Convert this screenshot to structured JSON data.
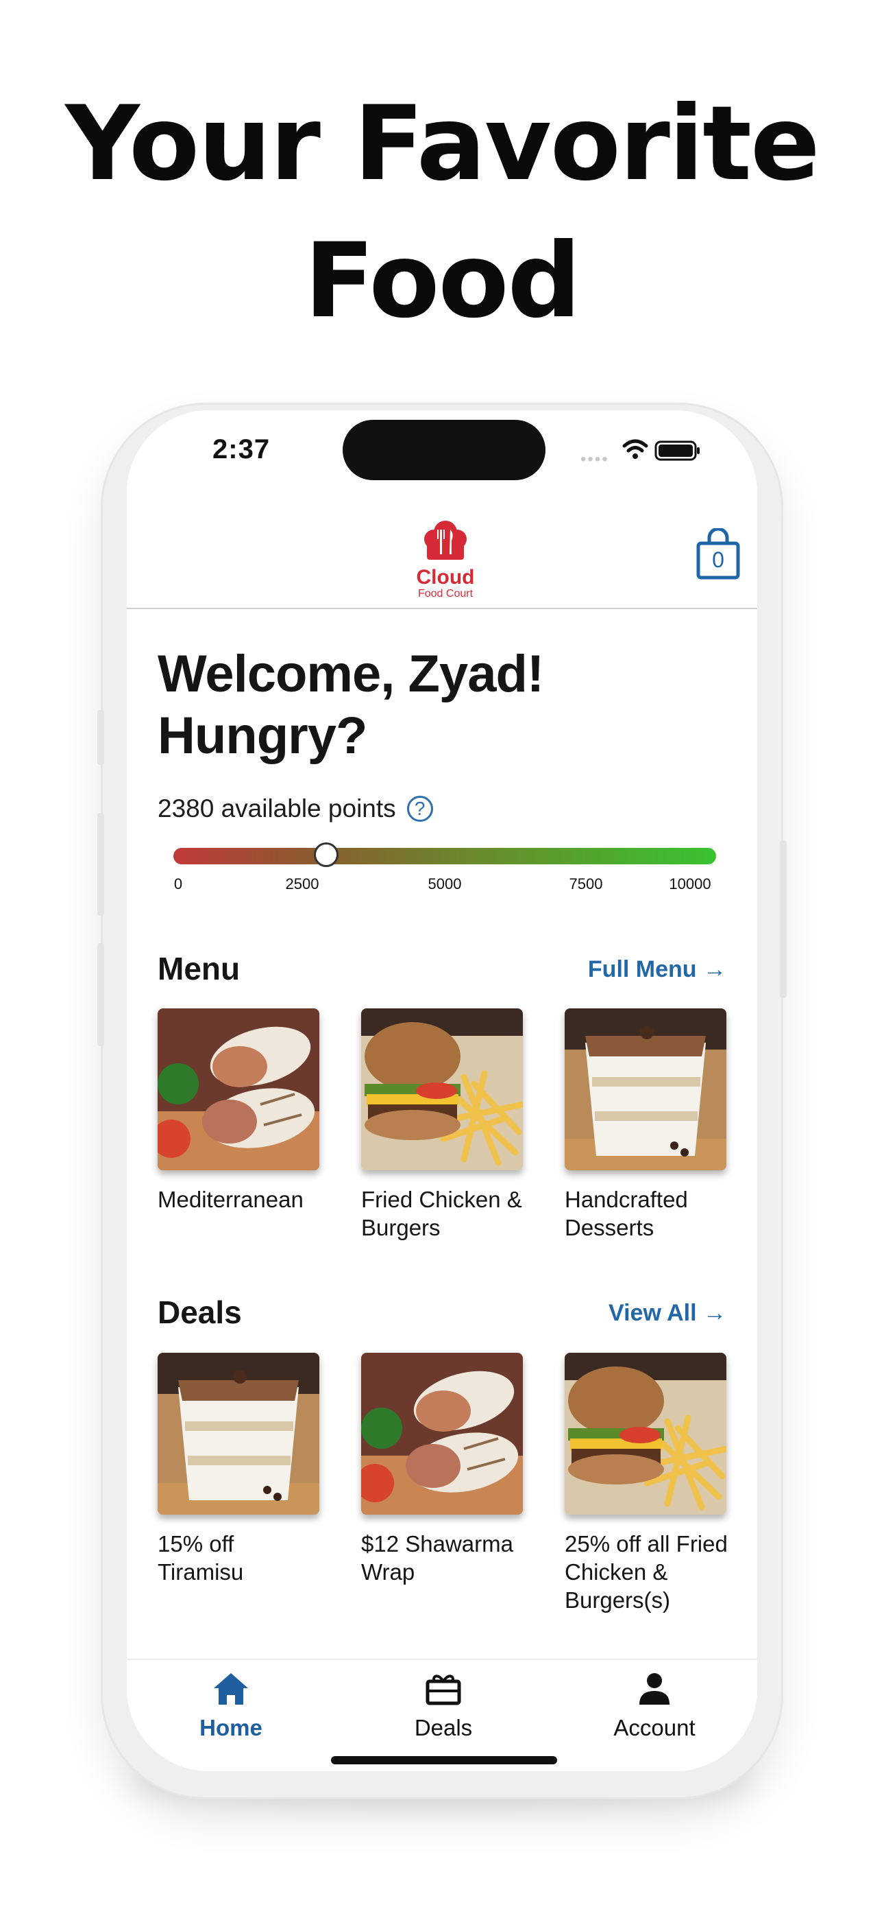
{
  "headline": {
    "line1": "Your Favorite",
    "line2": "Food"
  },
  "status_bar": {
    "time": "2:37"
  },
  "header": {
    "logo": {
      "name": "Cloud",
      "subtitle": "Food Court"
    },
    "cart_count": "0"
  },
  "welcome": {
    "line1": "Welcome, Zyad!",
    "line2": "Hungry?"
  },
  "points": {
    "label": "2380 available points",
    "help_glyph": "?",
    "value": 2380,
    "max": 10000,
    "ticks": [
      "0",
      "2500",
      "5000",
      "7500",
      "10000"
    ]
  },
  "menu": {
    "title": "Menu",
    "link": "Full Menu →",
    "items": [
      {
        "label": "Mediterranean",
        "image": "shawarma-wrap"
      },
      {
        "label": "Fried Chicken & Burgers",
        "image": "burger-fries"
      },
      {
        "label": "Handcrafted Desserts",
        "image": "tiramisu"
      }
    ]
  },
  "deals": {
    "title": "Deals",
    "link": "View All →",
    "items": [
      {
        "label": "15% off Tiramisu",
        "image": "tiramisu"
      },
      {
        "label": "$12 Shawarma Wrap",
        "image": "shawarma-wrap"
      },
      {
        "label": "25% off all Fried Chicken & Burgers(s)",
        "image": "burger-fries"
      }
    ]
  },
  "tabbar": {
    "tabs": [
      {
        "label": "Home",
        "icon": "home-icon",
        "active": true
      },
      {
        "label": "Deals",
        "icon": "gift-icon",
        "active": false
      },
      {
        "label": "Account",
        "icon": "person-icon",
        "active": false
      }
    ]
  },
  "colors": {
    "accent": "#2467a6",
    "brand_red": "#d62b36",
    "slider_start": "#c23a3a",
    "slider_end": "#38c230"
  }
}
